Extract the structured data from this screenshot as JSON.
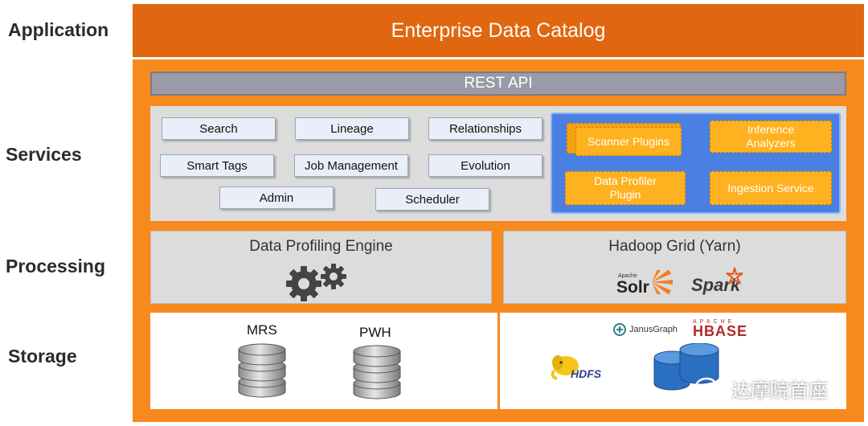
{
  "layers": {
    "application": "Application",
    "services": "Services",
    "processing": "Processing",
    "storage": "Storage"
  },
  "app_title": "Enterprise Data Catalog",
  "rest_api": "REST API",
  "services": [
    "Search",
    "Lineage",
    "Relationships",
    "Smart Tags",
    "Job Management",
    "Evolution",
    "Admin",
    "Scheduler"
  ],
  "plugins": {
    "scanner": "Scanner Plugins",
    "inference": "Inference Analyzers",
    "profiler": "Data Profiler Plugin",
    "ingestion": "Ingestion Service"
  },
  "processing": {
    "profiling_engine": "Data Profiling Engine",
    "hadoop": "Hadoop Grid (Yarn)",
    "solr_small": "Apache",
    "solr": "Solr",
    "spark": "Spark"
  },
  "storage": {
    "mrs": "MRS",
    "pwh": "PWH",
    "janus": "JanusGraph",
    "hbase_small": "APACHE",
    "hbase": "HBASE",
    "hdfs": "HDFS"
  },
  "watermark": "达摩院首座",
  "colors": {
    "app_bar": "#e0670f",
    "frame": "#f7891d",
    "plugin_panel": "#4a80e4",
    "plugin": "#ffb21f"
  }
}
